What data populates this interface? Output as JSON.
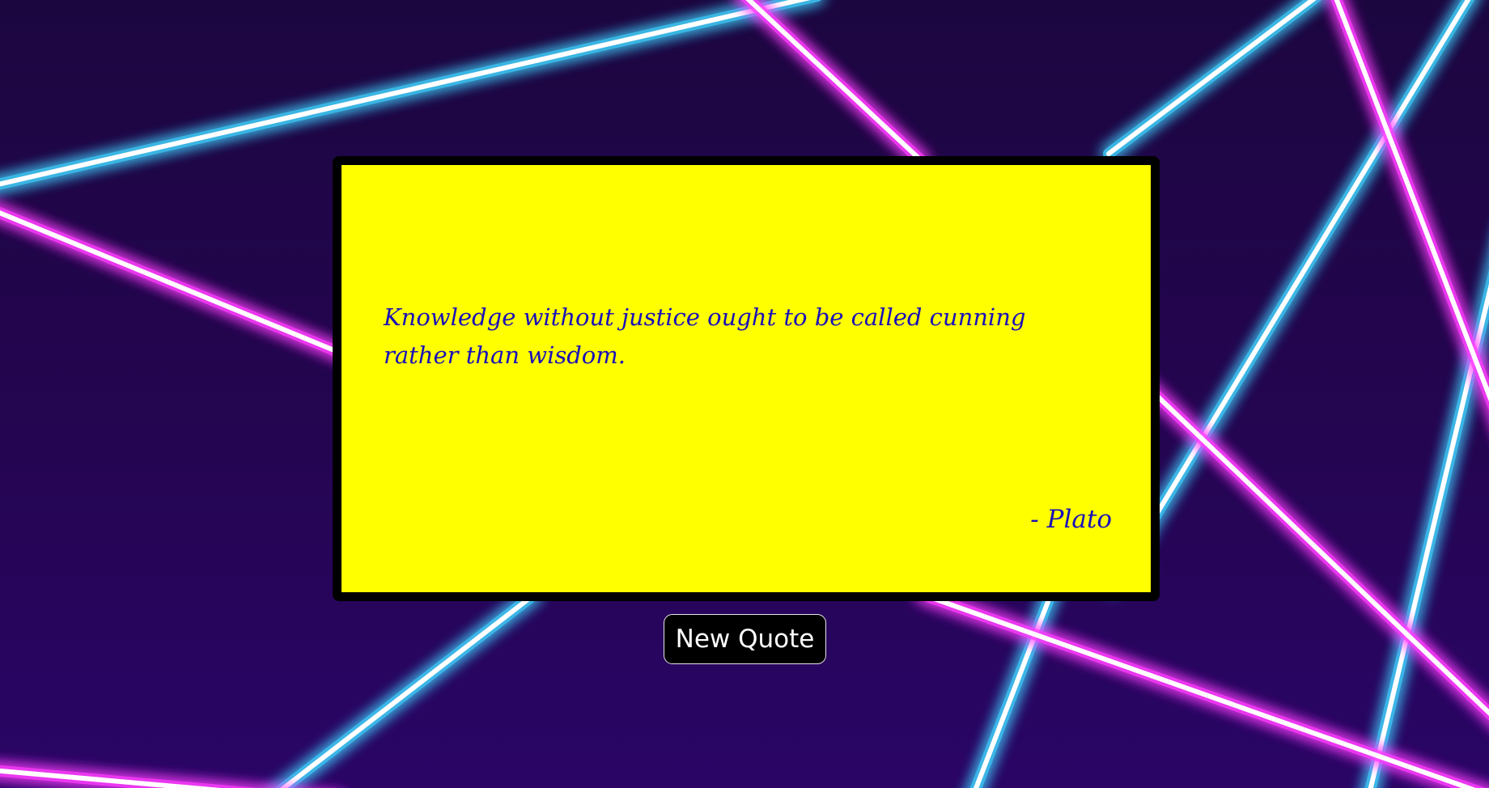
{
  "quote": {
    "text": "Knowledge without justice ought to be called cunning rather than wisdom.",
    "author": "- Plato"
  },
  "controls": {
    "new_quote_label": "New Quote"
  },
  "colors": {
    "card_background": "#ffff00",
    "card_border": "#000000",
    "quote_text": "#1a10b8",
    "button_background": "#000000",
    "button_text": "#ffffff",
    "neon_pink": "#ff3dff",
    "neon_cyan": "#3fd4ff",
    "background_dark": "#1c0640"
  }
}
